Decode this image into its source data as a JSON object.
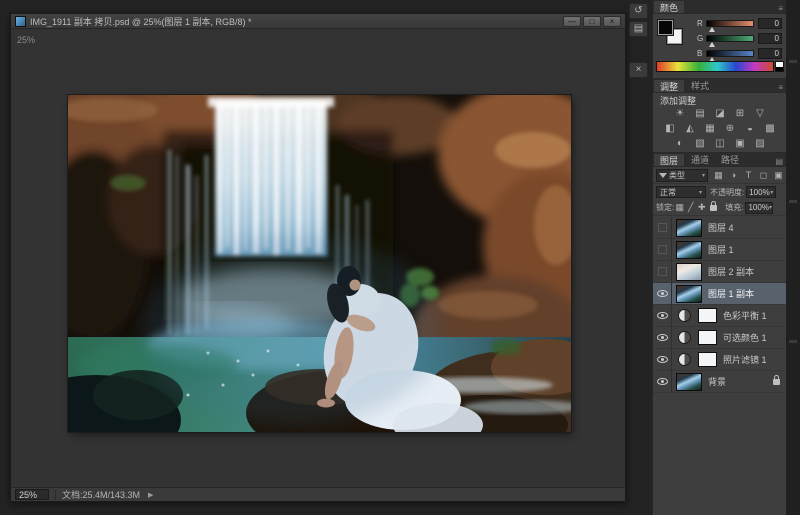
{
  "titlebar": {
    "title": "IMG_1911 副本 拷贝.psd @ 25%(图层 1 副本, RGB/8) *",
    "minimize": "—",
    "maximize": "□",
    "close": "×"
  },
  "canvas": {
    "zoom_label": "25%"
  },
  "statusbar": {
    "zoom": "25%",
    "doc_info": "文档:25.4M/143.3M",
    "expand": "▶"
  },
  "collapsed_strip": {
    "icon1": "↺",
    "icon2": "▤",
    "icon3": "×"
  },
  "color_panel": {
    "tab": "颜色",
    "menu": "≡",
    "sliders": [
      {
        "label": "R",
        "value": "0"
      },
      {
        "label": "G",
        "value": "0"
      },
      {
        "label": "B",
        "value": "0"
      }
    ]
  },
  "adjustments_panel": {
    "tab_active": "调整",
    "tab_inactive": "样式",
    "menu": "≡",
    "hint": "添加调整",
    "row1": [
      "☀",
      "▤",
      "◪",
      "⊞",
      "▽"
    ],
    "row2": [
      "◧",
      "◭",
      "▦",
      "⊕",
      "◒",
      "▩"
    ],
    "row3": [
      "◐",
      "▧",
      "◫",
      "▣",
      "▨"
    ]
  },
  "layers_panel": {
    "tabs": [
      "图层",
      "通道",
      "路径"
    ],
    "menu": "▤",
    "filter_label": "类型",
    "filter_caret": "▾",
    "filter_icons": [
      "▦",
      "◑",
      "T",
      "◻",
      "▣"
    ],
    "blend_mode": "正常",
    "caret": "▾",
    "opacity_label": "不透明度:",
    "opacity_value": "100%",
    "lock_label": "锁定:",
    "lock_icons": [
      "▦",
      "╱",
      "✚"
    ],
    "fill_label": "填充:",
    "fill_value": "100%",
    "layers": [
      {
        "name": "图层 4",
        "visible": false,
        "type": "image"
      },
      {
        "name": "图层 1",
        "visible": false,
        "type": "image"
      },
      {
        "name": "图层 2 副本",
        "visible": false,
        "type": "image"
      },
      {
        "name": "图层 1 副本",
        "visible": true,
        "type": "image",
        "selected": true
      },
      {
        "name": "色彩平衡 1",
        "visible": true,
        "type": "adjustment"
      },
      {
        "name": "可选颜色 1",
        "visible": true,
        "type": "adjustment"
      },
      {
        "name": "照片滤镜 1",
        "visible": true,
        "type": "adjustment"
      },
      {
        "name": "背景",
        "visible": true,
        "type": "background",
        "locked": true
      }
    ]
  },
  "colors": {
    "selection": "#57626d",
    "panel_bg": "#3e3e3e",
    "canvas_bg": "#333333"
  }
}
